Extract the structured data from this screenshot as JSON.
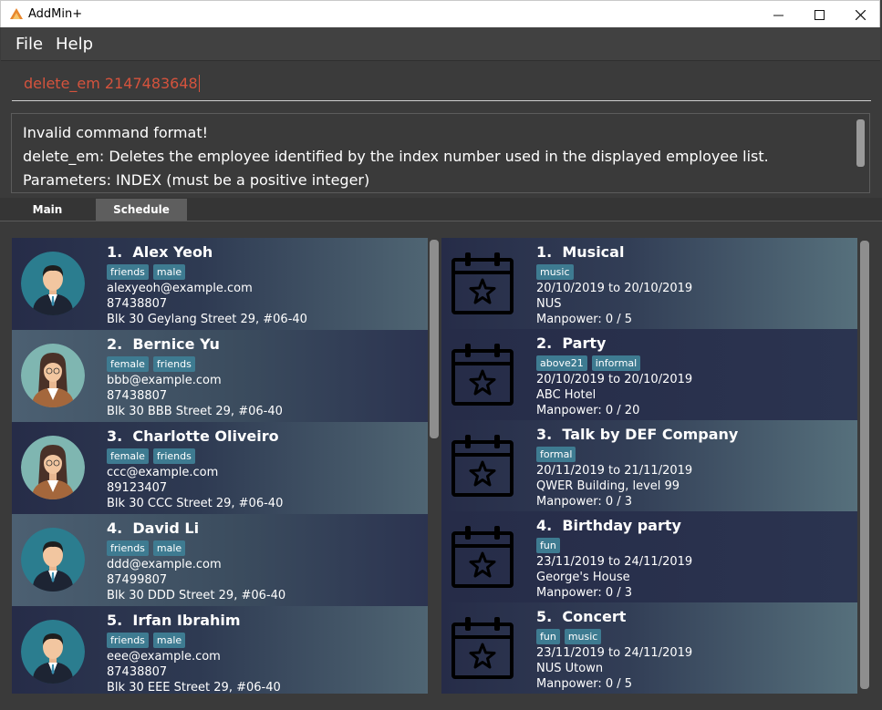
{
  "window": {
    "title": "AddMin+",
    "minimize": "—",
    "maximize": "☐",
    "close": "✕"
  },
  "menu": {
    "file": "File",
    "help": "Help"
  },
  "command": {
    "value": "delete_em 2147483648"
  },
  "result": {
    "lines": [
      "Invalid command format!",
      "delete_em: Deletes the employee identified by the index number used in the displayed employee list.",
      "Parameters: INDEX (must be a positive integer)"
    ]
  },
  "tabs": {
    "main": "Main",
    "schedule": "Schedule"
  },
  "employees": [
    {
      "index": "1.",
      "name": "Alex Yeoh",
      "tags": [
        "friends",
        "male"
      ],
      "email": "alexyeoh@example.com",
      "phone": "87438807",
      "address": "Blk 30 Geylang Street 29, #06-40",
      "gender": "male"
    },
    {
      "index": "2.",
      "name": "Bernice Yu",
      "tags": [
        "female",
        "friends"
      ],
      "email": "bbb@example.com",
      "phone": "87438807",
      "address": "Blk 30 BBB Street 29, #06-40",
      "gender": "female"
    },
    {
      "index": "3.",
      "name": "Charlotte Oliveiro",
      "tags": [
        "female",
        "friends"
      ],
      "email": "ccc@example.com",
      "phone": "89123407",
      "address": "Blk 30 CCC Street 29, #06-40",
      "gender": "female"
    },
    {
      "index": "4.",
      "name": "David Li",
      "tags": [
        "friends",
        "male"
      ],
      "email": "ddd@example.com",
      "phone": "87499807",
      "address": "Blk 30 DDD Street 29, #06-40",
      "gender": "male"
    },
    {
      "index": "5.",
      "name": "Irfan Ibrahim",
      "tags": [
        "friends",
        "male"
      ],
      "email": "eee@example.com",
      "phone": "87438807",
      "address": "Blk 30 EEE Street 29, #06-40",
      "gender": "male"
    }
  ],
  "events": [
    {
      "index": "1.",
      "name": "Musical",
      "tags": [
        "music"
      ],
      "dates": "20/10/2019 to 20/10/2019",
      "venue": "NUS",
      "manpower": "Manpower: 0 / 5"
    },
    {
      "index": "2.",
      "name": "Party",
      "tags": [
        "above21",
        "informal"
      ],
      "dates": "20/10/2019 to 20/10/2019",
      "venue": "ABC Hotel",
      "manpower": "Manpower: 0 / 20"
    },
    {
      "index": "3.",
      "name": "Talk by DEF Company",
      "tags": [
        "formal"
      ],
      "dates": "20/11/2019 to 21/11/2019",
      "venue": "QWER Building, level 99",
      "manpower": "Manpower: 0 / 3"
    },
    {
      "index": "4.",
      "name": "Birthday party",
      "tags": [
        "fun"
      ],
      "dates": "23/11/2019 to 24/11/2019",
      "venue": "George's House",
      "manpower": "Manpower: 0 / 3"
    },
    {
      "index": "5.",
      "name": "Concert",
      "tags": [
        "fun",
        "music"
      ],
      "dates": "23/11/2019 to 24/11/2019",
      "venue": "NUS Utown",
      "manpower": "Manpower: 0 / 5"
    }
  ],
  "colors": {
    "accent": "#d5533d",
    "tag": "#3e7b91"
  },
  "icons": {
    "app": "app-logo-icon",
    "employee": "avatar-icon",
    "event": "calendar-star-icon"
  }
}
